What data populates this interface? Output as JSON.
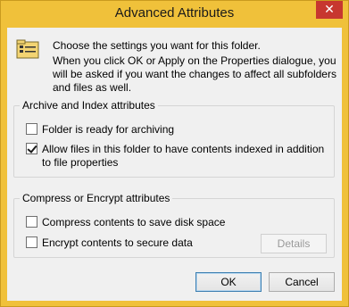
{
  "window": {
    "title": "Advanced Attributes",
    "close_icon": "close-icon"
  },
  "intro": {
    "icon": "folder-attributes-icon",
    "line1": "Choose the settings you want for this folder.",
    "line2": "When you click OK or Apply on the Properties dialogue, you will be asked if you want the changes to affect all subfolders and files as well."
  },
  "archive_group": {
    "legend": "Archive and Index attributes",
    "archive_label": "Folder is ready for archiving",
    "archive_checked": false,
    "index_label": "Allow files in this folder to have contents indexed in addition to file properties",
    "index_checked": true
  },
  "compress_group": {
    "legend": "Compress or Encrypt attributes",
    "compress_label": "Compress contents to save disk space",
    "compress_checked": false,
    "encrypt_label": "Encrypt contents to secure data",
    "encrypt_checked": false,
    "details_label": "Details"
  },
  "buttons": {
    "ok_label": "OK",
    "cancel_label": "Cancel"
  },
  "colors": {
    "titlebar": "#f0c13a",
    "close": "#c7372f",
    "client": "#f0f0f0"
  }
}
